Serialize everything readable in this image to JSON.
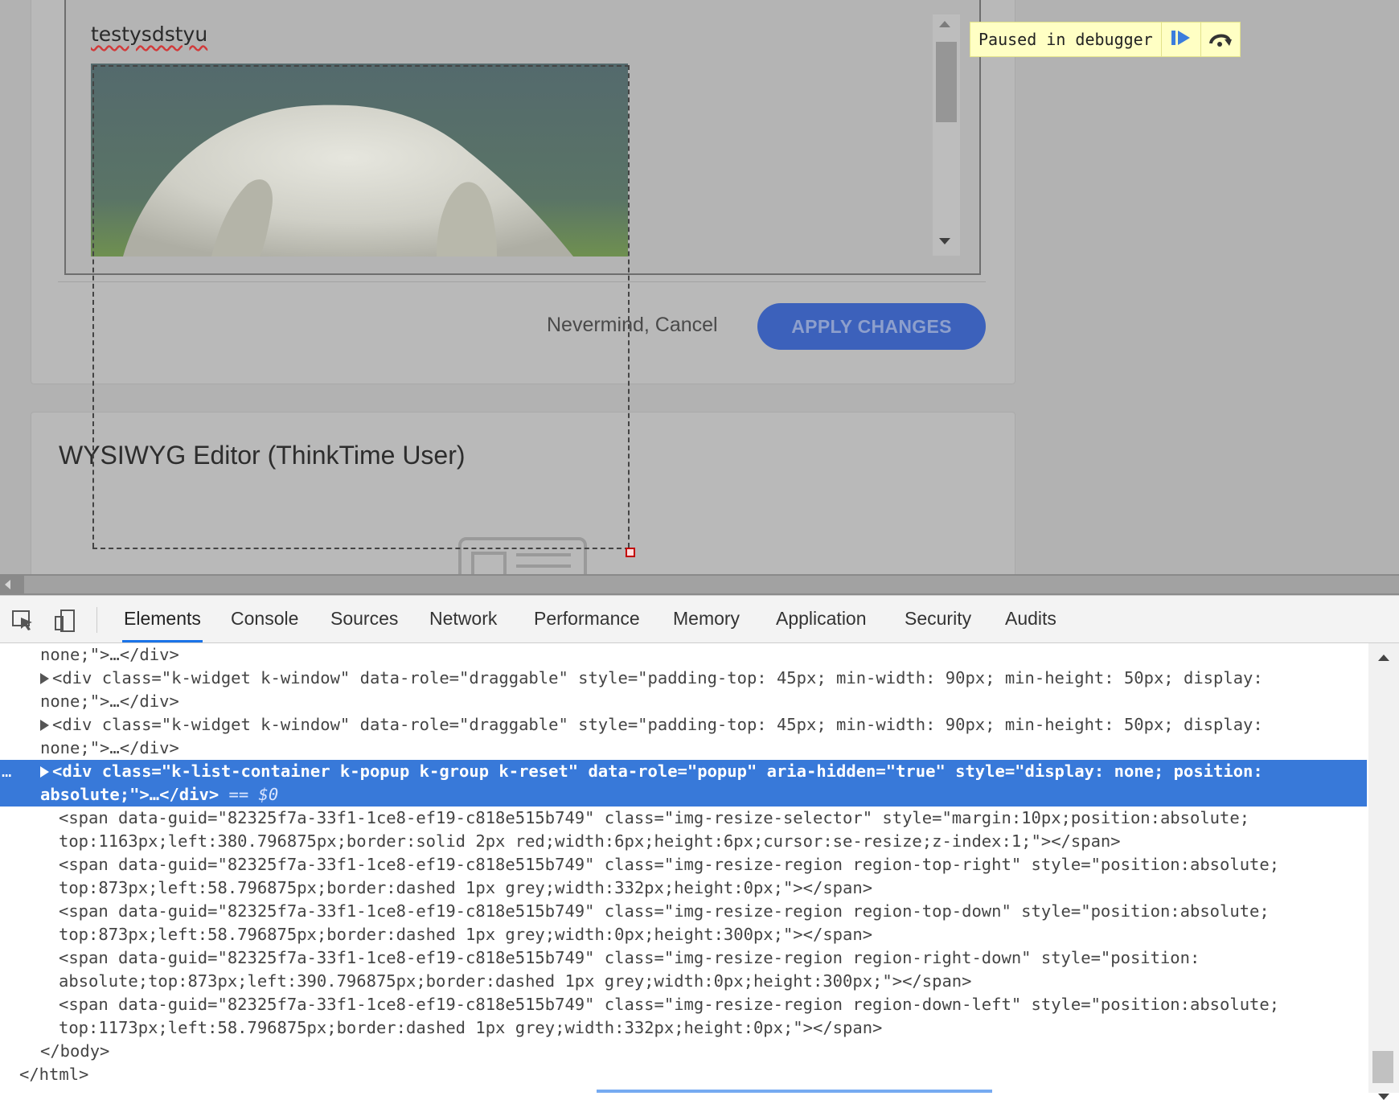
{
  "page": {
    "editor_text": "testysdstyu",
    "cancel_label": "Nevermind, Cancel",
    "apply_label": "APPLY CHANGES",
    "wysiwyg_title": "WYSIWYG Editor (ThinkTime User)"
  },
  "debugger": {
    "label": "Paused in debugger",
    "resume_icon": "resume-icon",
    "step_over_icon": "step-over-icon"
  },
  "devtools": {
    "tabs": [
      "Elements",
      "Console",
      "Sources",
      "Network",
      "Performance",
      "Memory",
      "Application",
      "Security",
      "Audits"
    ],
    "active_tab": "Elements",
    "selected_suffix": " == $0"
  },
  "dom_lines": [
    "none;\">…</div>",
    "<div class=\"k-widget k-window\" data-role=\"draggable\" style=\"padding-top: 45px; min-width: 90px; min-height: 50px; display:",
    "none;\">…</div>",
    "<div class=\"k-widget k-window\" data-role=\"draggable\" style=\"padding-top: 45px; min-width: 90px; min-height: 50px; display:",
    "none;\">…</div>",
    "<div class=\"k-list-container k-popup k-group k-reset\" data-role=\"popup\" aria-hidden=\"true\" style=\"display: none; position:",
    "absolute;\">…</div>",
    "<span data-guid=\"82325f7a-33f1-1ce8-ef19-c818e515b749\" class=\"img-resize-selector\" style=\"margin:10px;position:absolute;",
    "top:1163px;left:380.796875px;border:solid 2px red;width:6px;height:6px;cursor:se-resize;z-index:1;\"></span>",
    "<span data-guid=\"82325f7a-33f1-1ce8-ef19-c818e515b749\" class=\"img-resize-region region-top-right\" style=\"position:absolute;",
    "top:873px;left:58.796875px;border:dashed 1px grey;width:332px;height:0px;\"></span>",
    "<span data-guid=\"82325f7a-33f1-1ce8-ef19-c818e515b749\" class=\"img-resize-region region-top-down\" style=\"position:absolute;",
    "top:873px;left:58.796875px;border:dashed 1px grey;width:0px;height:300px;\"></span>",
    "<span data-guid=\"82325f7a-33f1-1ce8-ef19-c818e515b749\" class=\"img-resize-region region-right-down\" style=\"position:",
    "absolute;top:873px;left:390.796875px;border:dashed 1px grey;width:0px;height:300px;\"></span>",
    "<span data-guid=\"82325f7a-33f1-1ce8-ef19-c818e515b749\" class=\"img-resize-region region-down-left\" style=\"position:absolute;",
    "top:1173px;left:58.796875px;border:dashed 1px grey;width:332px;height:0px;\"></span>",
    "</body>",
    "</html>"
  ]
}
